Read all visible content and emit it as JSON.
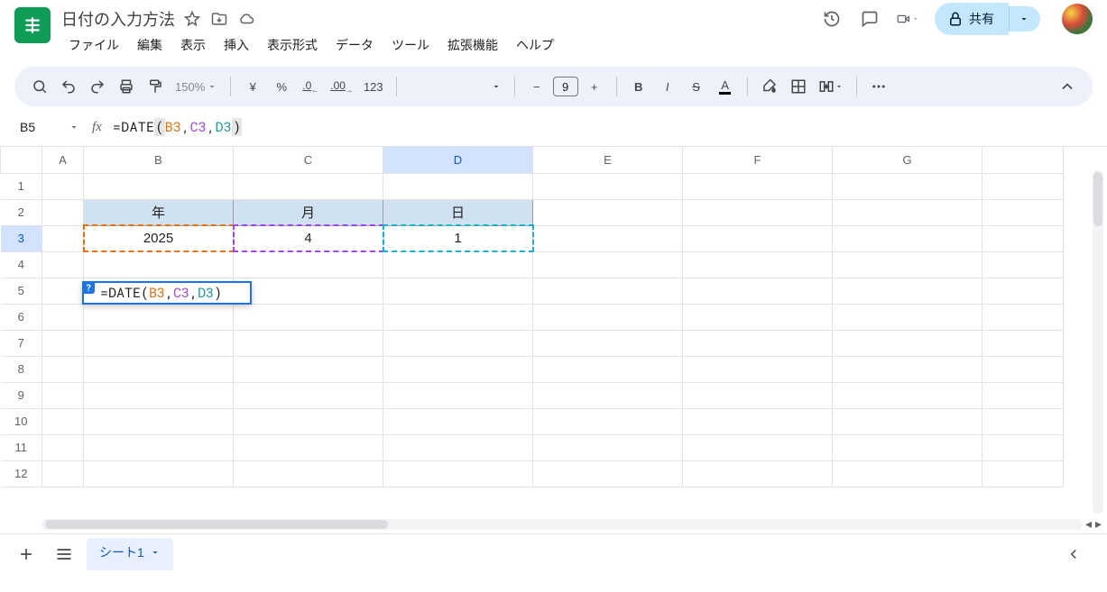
{
  "doc": {
    "title": "日付の入力方法"
  },
  "menu": {
    "file": "ファイル",
    "edit": "編集",
    "view": "表示",
    "insert": "挿入",
    "format": "表示形式",
    "data": "データ",
    "tools": "ツール",
    "extensions": "拡張機能",
    "help": "ヘルプ"
  },
  "toolbar": {
    "zoom": "150%",
    "currency": "¥",
    "percent": "%",
    "dec_dec": ".0",
    "dec_inc": ".00",
    "fmt123": "123",
    "font_family": "",
    "font_size": "9"
  },
  "share": {
    "label": "共有"
  },
  "namebox": {
    "value": "B5"
  },
  "formula": {
    "eq": "=",
    "fn": "DATE",
    "open": "(",
    "ref1": "B3",
    "comma1": ",",
    "ref2": "C3",
    "comma2": ",",
    "ref3": "D3",
    "close": ")"
  },
  "columns": [
    "A",
    "B",
    "C",
    "D",
    "E",
    "F",
    "G",
    ""
  ],
  "rows": [
    "1",
    "2",
    "3",
    "4",
    "5",
    "6",
    "7",
    "8",
    "9",
    "10",
    "11",
    "12"
  ],
  "headers_row2": {
    "B": "年",
    "C": "月",
    "D": "日"
  },
  "data_row3": {
    "B": "2025",
    "C": "4",
    "D": "1"
  },
  "sheettab": {
    "name": "シート1"
  },
  "active": {
    "col": "D",
    "row": "3",
    "editing_cell": "B5"
  },
  "help_badge": "?"
}
